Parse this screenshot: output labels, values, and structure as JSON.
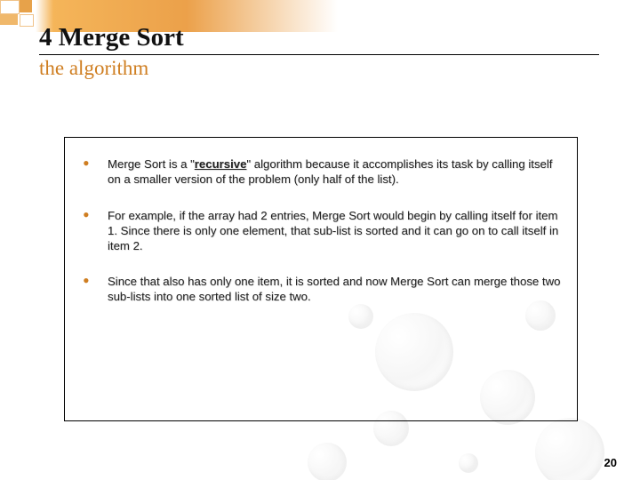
{
  "chapter_number": "4",
  "heading": "Merge Sort",
  "subtitle": "the algorithm",
  "bullets": [
    {
      "before": "Merge Sort is a \"",
      "bold_underline": "recursive",
      "after": "\" algorithm because it accomplishes its task by calling itself on a smaller version of the problem (only half of the list)."
    },
    {
      "before": "For example, if the array had 2 entries, Merge Sort would begin by calling itself for item 1. Since there is only one element, that sub-list is sorted and it can go on to call itself in item 2.",
      "bold_underline": "",
      "after": ""
    },
    {
      "before": "Since that also has only one item, it is sorted and now Merge Sort can merge those two sub-lists into one sorted list of size two.",
      "bold_underline": "",
      "after": ""
    }
  ],
  "page_number": "20"
}
